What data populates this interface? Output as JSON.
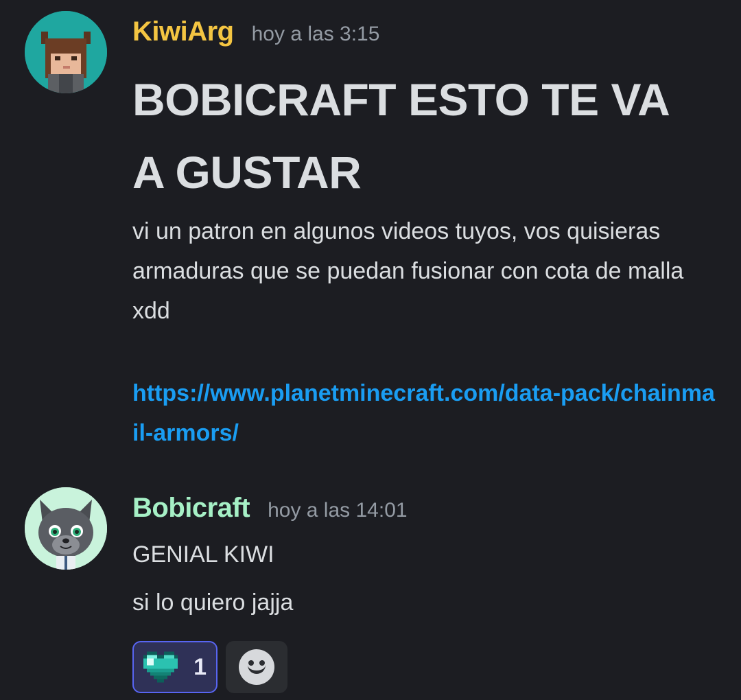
{
  "messages": [
    {
      "username": "KiwiArg",
      "timestamp": "hoy a las 3:15",
      "heading": "BOBICRAFT ESTO TE VA A GUSTAR",
      "text": "vi un patron en algunos videos tuyos, vos quisieras armaduras que se puedan fusionar con cota de malla xdd",
      "link": "https://www.planetminecraft.com/data-pack/chainmail-armors/"
    },
    {
      "username": "Bobicraft",
      "timestamp": "hoy a las 14:01",
      "lines": [
        "GENIAL KIWI",
        "si lo quiero jajja"
      ],
      "reactions": [
        {
          "emoji": "diamond-heart-icon",
          "count": "1",
          "active": true
        }
      ]
    }
  ],
  "colors": {
    "background": "#1c1d22",
    "kiwi_name": "#f4c542",
    "bobi_name": "#a6f0c6",
    "link": "#1a9df2",
    "reaction_active_border": "#5865f2"
  }
}
